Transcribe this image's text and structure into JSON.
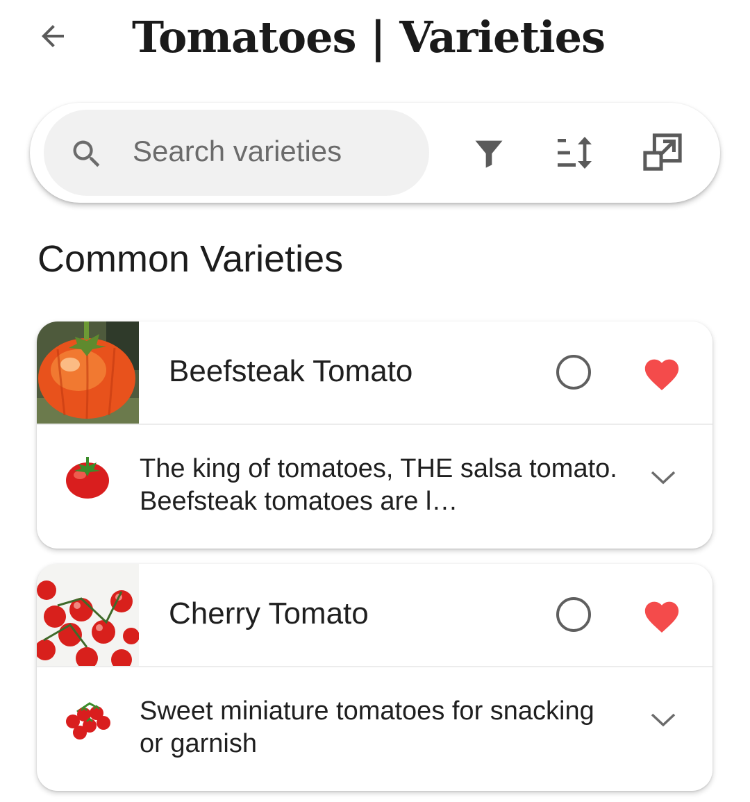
{
  "header": {
    "title": "Tomatoes | Varieties",
    "back_icon": "arrow-left-icon"
  },
  "toolbar": {
    "search_placeholder": "Search varieties",
    "search_value": "",
    "icons": [
      "search-icon",
      "filter-icon",
      "sort-icon",
      "open-in-new-icon"
    ]
  },
  "section": {
    "title": "Common Varieties"
  },
  "varieties": [
    {
      "name": "Beefsteak Tomato",
      "description": "The king of tomatoes, THE salsa tomato. Beefsteak tomatoes are l…",
      "favorite": true,
      "selected": false,
      "emoji_icon": "tomato-icon"
    },
    {
      "name": "Cherry Tomato",
      "description": "Sweet miniature tomatoes for snacking or garnish",
      "favorite": true,
      "selected": false,
      "emoji_icon": "cherry-tomatoes-icon"
    }
  ],
  "colors": {
    "heart": "#f44b4b",
    "icon": "#5a5a5a",
    "search_bg": "#f1f1f1"
  }
}
